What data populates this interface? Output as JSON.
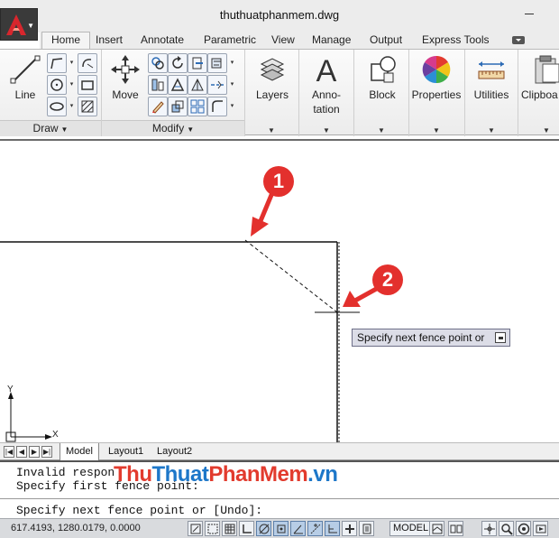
{
  "window": {
    "title": "thuthuatphanmem.dwg"
  },
  "ribbon": {
    "tabs": [
      "Home",
      "Insert",
      "Annotate",
      "Parametric",
      "View",
      "Manage",
      "Output",
      "Express Tools"
    ],
    "active_tab": "Home",
    "panels": {
      "draw": "Draw",
      "modify": "Modify"
    },
    "buttons": {
      "line": "Line",
      "move": "Move",
      "layers": "Layers",
      "annotation_line1": "Anno-",
      "annotation_line2": "tation",
      "block": "Block",
      "properties": "Properties",
      "utilities": "Utilities",
      "clipboard": "Clipboa"
    }
  },
  "canvas": {
    "tooltip": "Specify next fence point or",
    "markers": [
      "1",
      "2"
    ],
    "ucs_x": "X",
    "ucs_y": "Y"
  },
  "layout_tabs": [
    "Model",
    "Layout1",
    "Layout2"
  ],
  "command": {
    "line1": "Invalid respon",
    "line2": "Specify first fence point:",
    "input": "Specify next fence point or [Undo]:"
  },
  "watermark": {
    "part1": "Thu",
    "part2": "Thuat",
    "part3": "PhanMem",
    "part4": ".vn"
  },
  "status": {
    "coordinates": "617.4193, 1280.0179, 0.0000",
    "model": "MODEL"
  },
  "colors": {
    "marker": "#e3302d",
    "tooltip_bg": "#dcdde7",
    "watermark_red": "#e23b2e",
    "watermark_blue": "#1d77c9"
  }
}
